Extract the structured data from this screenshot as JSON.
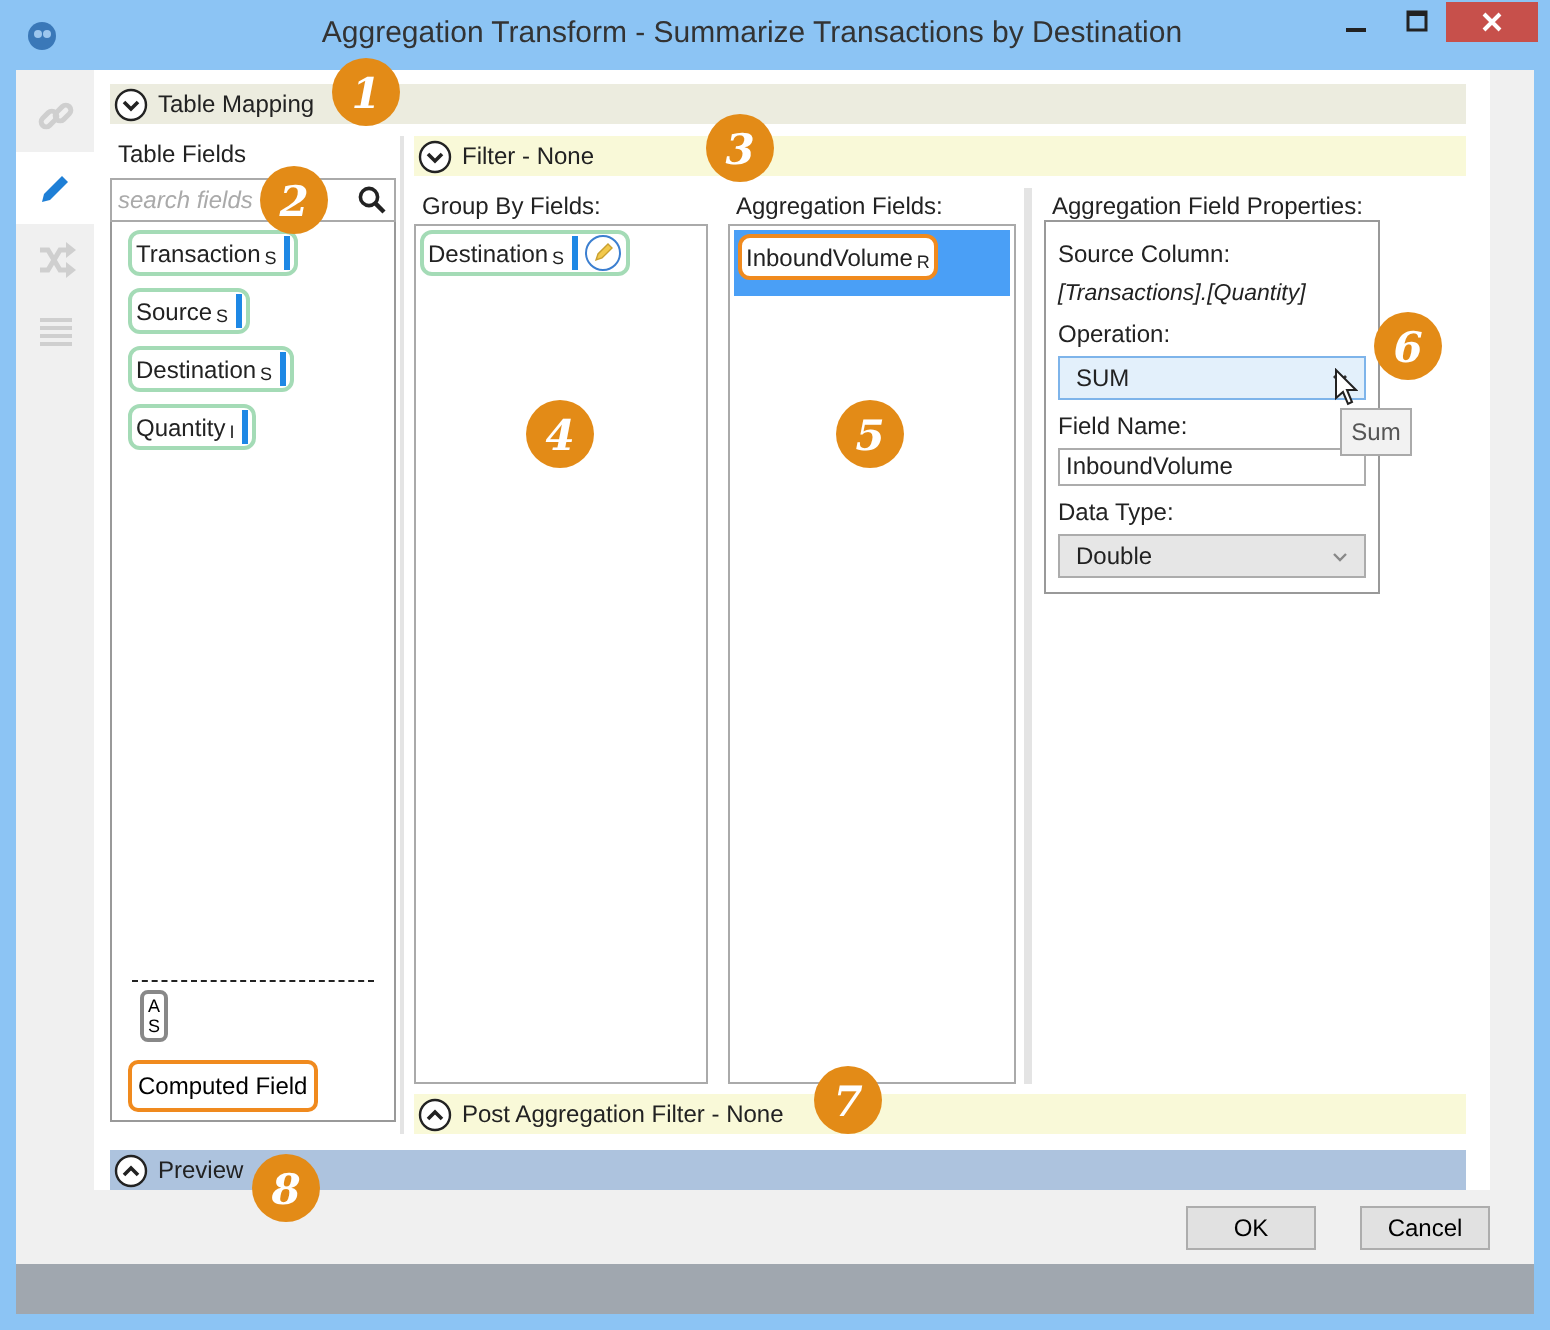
{
  "window": {
    "title": "Aggregation Transform - Summarize Transactions by Destination"
  },
  "sidebar": {
    "tools": [
      {
        "selected": false
      },
      {
        "selected": true
      },
      {
        "selected": false
      },
      {
        "selected": false
      }
    ]
  },
  "table_mapping": {
    "title": "Table Mapping",
    "expanded": true
  },
  "table_fields": {
    "title": "Table Fields",
    "search": {
      "placeholder": "search fields"
    },
    "fields": [
      {
        "name": "Transaction",
        "type": "S"
      },
      {
        "name": "Source",
        "type": "S"
      },
      {
        "name": "Destination",
        "type": "S"
      },
      {
        "name": "Quantity",
        "type": "I"
      }
    ],
    "sort_button": [
      "A",
      "S"
    ],
    "computed_field_button": "Computed Field"
  },
  "filter": {
    "title": "Filter - None",
    "expanded": true
  },
  "group_by": {
    "title": "Group By Fields:",
    "fields": [
      {
        "name": "Destination",
        "type": "S"
      }
    ]
  },
  "aggregation": {
    "title": "Aggregation Fields:",
    "fields": [
      {
        "name": "InboundVolume",
        "type": "R",
        "selected": true
      }
    ]
  },
  "properties": {
    "title": "Aggregation Field Properties:",
    "source_column_label": "Source Column:",
    "source_column": "[Transactions].[Quantity]",
    "operation_label": "Operation:",
    "operation": "SUM",
    "tooltip": "Sum",
    "field_name_label": "Field Name:",
    "field_name": "InboundVolume",
    "data_type_label": "Data Type:",
    "data_type": "Double"
  },
  "post_aggregation_filter": {
    "title": "Post Aggregation Filter - None",
    "expanded": false
  },
  "preview": {
    "title": "Preview",
    "expanded": false
  },
  "callouts": [
    "1",
    "2",
    "3",
    "4",
    "5",
    "6",
    "7",
    "8"
  ],
  "buttons": [
    "OK",
    "Cancel"
  ]
}
